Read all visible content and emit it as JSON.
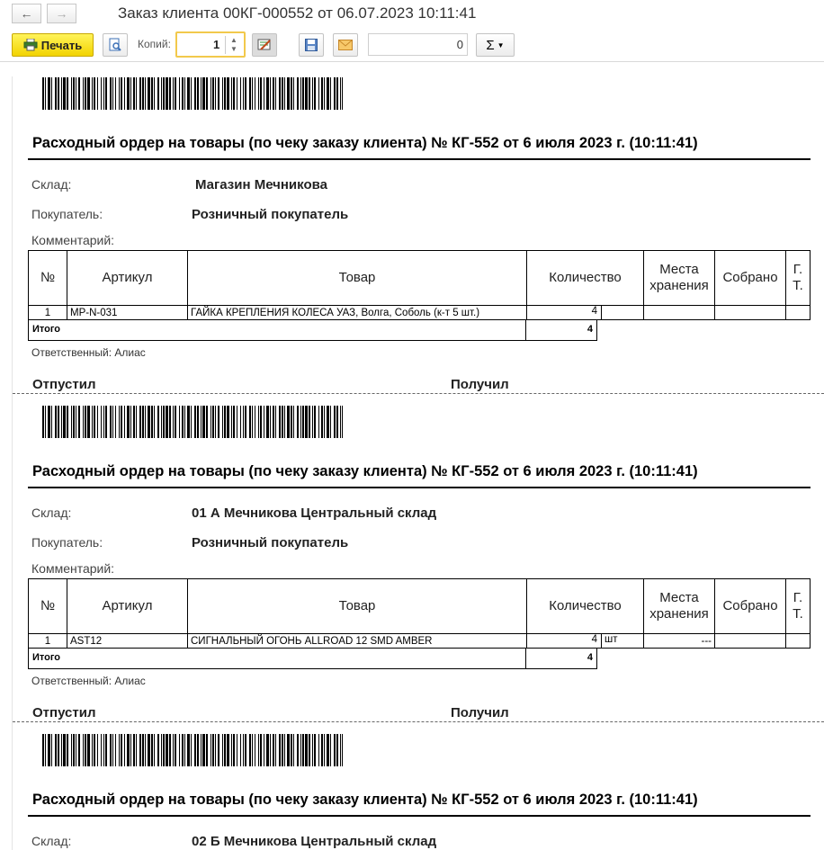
{
  "window": {
    "title": "Заказ клиента 00КГ-000552 от 06.07.2023 10:11:41",
    "back_icon": "arrow-left-icon",
    "forward_icon": "arrow-right-icon"
  },
  "toolbar": {
    "print_label": "Печать",
    "copies_label": "Копий:",
    "copies_value": "1",
    "number_field_value": "0",
    "sum_symbol": "Σ",
    "sum_dropdown_icon": "chevron-down-icon",
    "icons": [
      "printer-icon",
      "preview-icon",
      "edit-icon",
      "save-icon",
      "mail-icon"
    ]
  },
  "documents": [
    {
      "title": "Расходный ордер на товары (по чеку заказу клиента) № КГ-552 от 6 июля 2023 г. (10:11:41)",
      "warehouse_label": "Склад:",
      "warehouse": "Магазин Мечникова",
      "buyer_label": "Покупатель:",
      "buyer": "Розничный покупатель",
      "comment_label": "Комментарий:",
      "columns": [
        "№",
        "Артикул",
        "Товар",
        "Количество",
        "Места хранения",
        "Собрано",
        "Г. Т."
      ],
      "rows": [
        {
          "n": "1",
          "sku": "MP-N-031",
          "name": "ГАЙКА КРЕПЛЕНИЯ КОЛЕСА УАЗ, Волга, Соболь (к-т 5 шт.)",
          "qty": "4",
          "unit": "",
          "place": "",
          "collected": "",
          "gt": ""
        }
      ],
      "total_label": "Итого",
      "total_value": "4",
      "responsible": "Ответственный: Алиас",
      "released_label": "Отпустил",
      "received_label": "Получил"
    },
    {
      "title": "Расходный ордер на товары (по чеку заказу клиента) № КГ-552 от 6 июля 2023 г. (10:11:41)",
      "warehouse_label": "Склад:",
      "warehouse": "01 А Мечникова Центральный склад",
      "buyer_label": "Покупатель:",
      "buyer": "Розничный покупатель",
      "comment_label": "Комментарий:",
      "columns": [
        "№",
        "Артикул",
        "Товар",
        "Количество",
        "Места хранения",
        "Собрано",
        "Г. Т."
      ],
      "rows": [
        {
          "n": "1",
          "sku": "AST12",
          "name": "СИГНАЛЬНЫЙ ОГОНЬ ALLROAD 12 SMD AMBER",
          "qty": "4",
          "unit": "шт",
          "place": "---",
          "collected": "",
          "gt": ""
        }
      ],
      "total_label": "Итого",
      "total_value": "4",
      "responsible": "Ответственный: Алиас",
      "released_label": "Отпустил",
      "received_label": "Получил"
    },
    {
      "title": "Расходный ордер на товары (по чеку заказу клиента) № КГ-552 от 6 июля 2023 г. (10:11:41)",
      "warehouse_label": "Склад:",
      "warehouse": "02 Б Мечникова Центральный склад"
    }
  ]
}
